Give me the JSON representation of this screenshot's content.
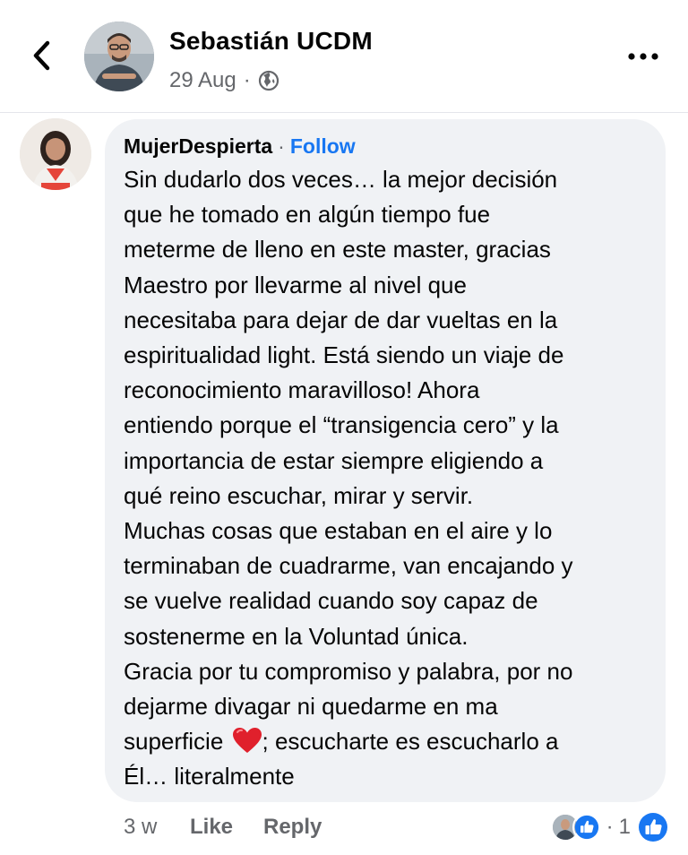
{
  "header": {
    "author_name": "Sebastián UCDM",
    "post_date": "29 Aug",
    "separator": "·",
    "privacy_icon": "globe-icon",
    "back_icon": "chevron-left-icon",
    "more_icon": "more-horizontal-icon"
  },
  "comment": {
    "commenter": "MujerDespierta",
    "separator": "·",
    "follow_label": "Follow",
    "lines": [
      "Sin dudarlo dos veces… la mejor decisión",
      "que he tomado en algún tiempo fue",
      "meterme de lleno en este master, gracias",
      "Maestro por llevarme al nivel que",
      "necesitaba para dejar de dar vueltas en la",
      "espiritualidad light. Está siendo un viaje de",
      "reconocimiento maravilloso! Ahora",
      "entiendo porque el “transigencia cero” y la",
      "importancia de estar siempre eligiendo a",
      "qué reino escuchar, mirar y servir.",
      "Muchas cosas que estaban en el aire y lo",
      "terminaban de cuadrarme, van encajando y",
      "se vuelve realidad cuando soy capaz de",
      "sostenerme en la Voluntad única.",
      "Gracia por tu compromiso y palabra, por no",
      "dejarme divagar ni quedarme en ma"
    ],
    "line_heart_before": "superficie",
    "line_heart_after": "; escucharte es escucharlo a",
    "last_line": "Él… literalmente",
    "emoji_icon": "red-heart-icon"
  },
  "actions": {
    "time": "3 w",
    "like_label": "Like",
    "reply_label": "Reply",
    "reaction_separator": "·",
    "reaction_count": "1"
  },
  "colors": {
    "link_blue": "#1877f2",
    "bubble_bg": "#f0f2f5",
    "secondary_text": "#65676b"
  }
}
